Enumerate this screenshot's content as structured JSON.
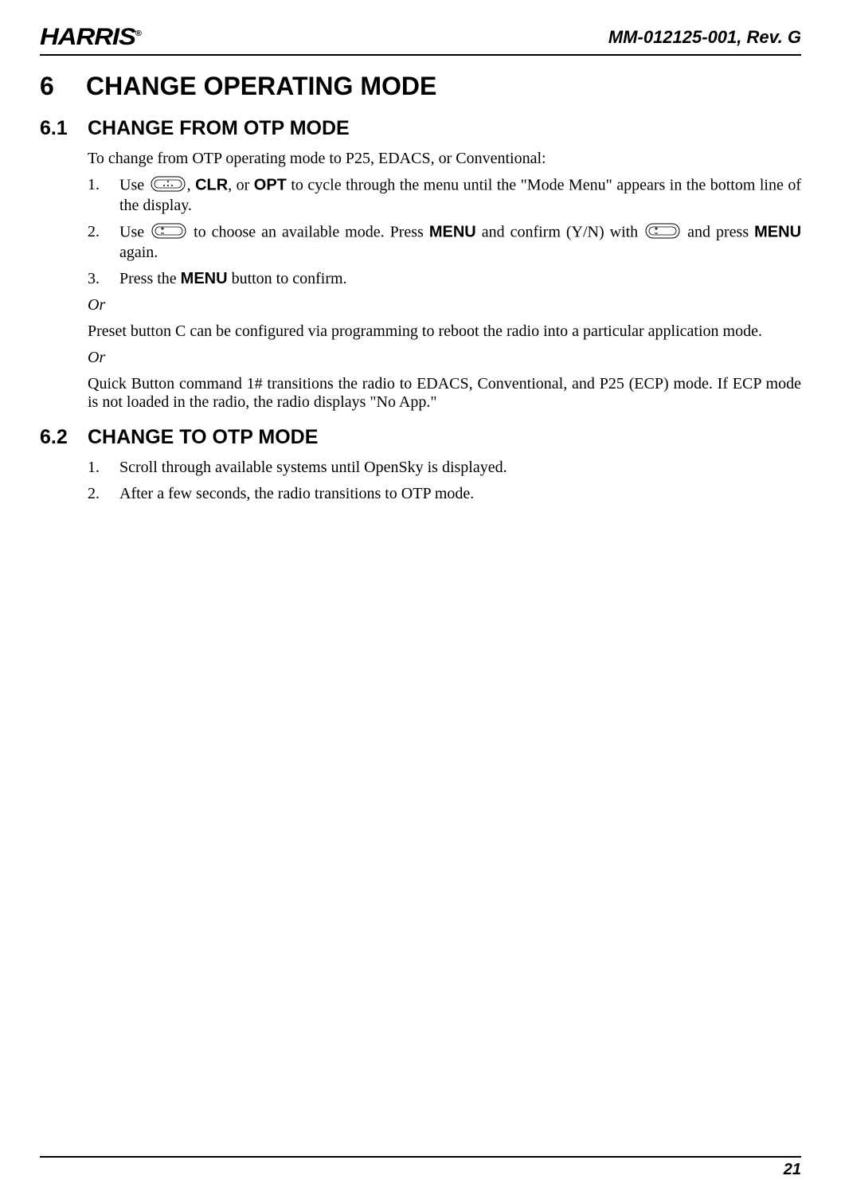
{
  "header": {
    "logo_text": "HARRIS",
    "logo_reg": "®",
    "doc_id": "MM-012125-001, Rev. G"
  },
  "section": {
    "num": "6",
    "title": "CHANGE OPERATING MODE"
  },
  "sub1": {
    "num": "6.1",
    "title": "CHANGE FROM OTP MODE",
    "intro": "To change from OTP operating mode to P25, EDACS, or Conventional:",
    "items": [
      {
        "num": "1.",
        "parts": {
          "a": "Use ",
          "b": ", ",
          "clr": "CLR",
          "c": ", or ",
          "opt": "OPT",
          "d": " to cycle through the menu until the \"Mode Menu\" appears in the bottom line of the display."
        }
      },
      {
        "num": "2.",
        "parts": {
          "a": "Use ",
          "b": " to choose an available mode. Press ",
          "menu1": "MENU",
          "c": " and confirm (Y/N) with ",
          "d": " and press ",
          "menu2": "MENU",
          "e": " again."
        }
      },
      {
        "num": "3.",
        "parts": {
          "a": "Press the ",
          "menu": "MENU",
          "b": " button to confirm."
        }
      }
    ],
    "or1": "Or",
    "para1": "Preset button C can be configured via programming to reboot the radio into a particular application mode.",
    "or2": "Or",
    "para2": "Quick Button command 1# transitions the radio to EDACS, Conventional, and P25 (ECP) mode. If ECP mode is not loaded in the radio, the radio displays \"No App.\""
  },
  "sub2": {
    "num": "6.2",
    "title": "CHANGE TO OTP MODE",
    "items": [
      {
        "num": "1.",
        "text": "Scroll through available systems until OpenSky is displayed."
      },
      {
        "num": "2.",
        "text": "After a few seconds, the radio transitions to OTP mode."
      }
    ]
  },
  "footer": {
    "page_num": "21"
  }
}
